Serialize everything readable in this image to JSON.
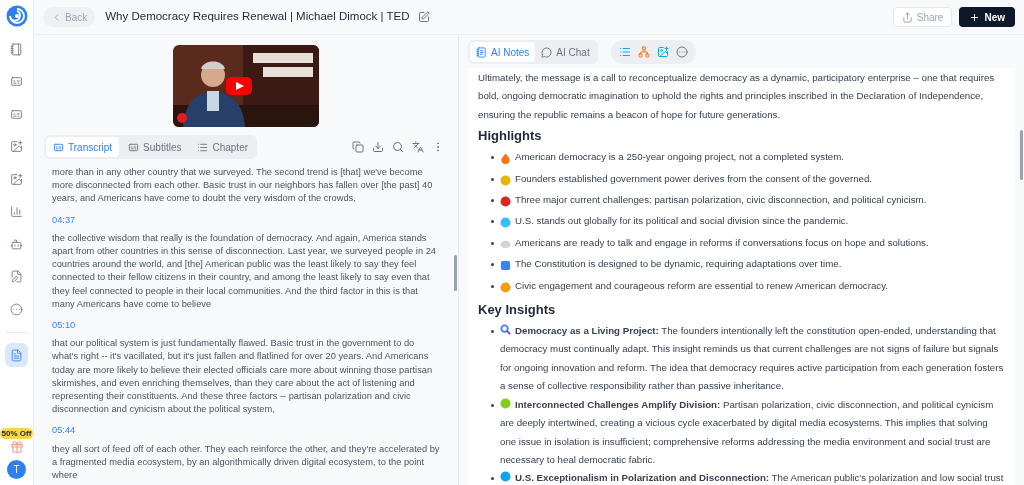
{
  "header": {
    "back": "Back",
    "title": "Why Democracy Requires Renewal | Michael Dimock | TED",
    "share": "Share",
    "new": "New"
  },
  "sidebar": {
    "items": [
      {
        "selected": false
      },
      {
        "selected": false
      },
      {
        "selected": false
      },
      {
        "selected": false
      },
      {
        "selected": false
      },
      {
        "selected": false
      },
      {
        "selected": false
      },
      {
        "selected": false
      },
      {
        "selected": false
      },
      {
        "selected": true
      }
    ],
    "promo": "50% Off",
    "avatar": "T"
  },
  "transcript_tabs": [
    {
      "label": "Transcript",
      "selected": true
    },
    {
      "label": "Subtitles",
      "selected": false
    },
    {
      "label": "Chapter",
      "selected": false
    }
  ],
  "transcript": [
    {
      "text": "more than in any other country that we surveyed. The second trend is [that] we've become more disconnected from each other. Basic trust in our neighbors has fallen over [the past] 40 years, and Americans have come to doubt the very wisdom of the crowds,"
    },
    {
      "time": "04:37",
      "text": "the collective wisdom that really is the foundation of democracy. And again, America stands apart from other countries in this sense of disconnection. Last year, we surveyed people in 24 countries around the world, and [the] American public was the least likely to say they feel connected to their fellow citizens in their country, and among the least likely to say even that they feel connected to people in their local communities. And the third factor in this is that many Americans have come to believe"
    },
    {
      "time": "05:10",
      "text": "that our political system is just fundamentally flawed. Basic trust in the government to do what's right -- it's vacillated, but it's just fallen and flatlined for over 20 years. And Americans today are more likely to believe their elected officials care more about winning those partisan skirmishes, and even enriching themselves, than they care about the act of listening and representing their constituents. And these three factors -- partisan polarization and civic disconnection and cynicism about the political system,"
    },
    {
      "time": "05:44",
      "text": "they all sort of feed off of each other. They each reinforce the other, and they're accelerated by a fragmented media ecosystem, by an algorithmically driven digital ecosystem, to the point where"
    }
  ],
  "notes_tabs": [
    {
      "label": "AI Notes",
      "selected": true
    },
    {
      "label": "AI Chat",
      "selected": false
    }
  ],
  "notes": {
    "intro": "Ultimately, the message is a call to reconceptualize democracy as a dynamic, participatory enterprise – one that requires bold, ongoing democratic imagination to uphold the rights and principles inscribed in the Declaration of Independence, ensuring the republic remains a beacon of hope for future generations.",
    "sections": [
      {
        "heading": "Highlights",
        "items": [
          "American democracy is a 250-year ongoing project, not a completed system.",
          "Founders established government power derives from the consent of the governed.",
          "Three major current challenges: partisan polarization, civic disconnection, and political cynicism.",
          "U.S. stands out globally for its political and social division since the pandemic.",
          "Americans are ready to talk and engage in reforms if conversations focus on hope and solutions.",
          "The Constitution is designed to be dynamic, requiring adaptations over time.",
          "Civic engagement and courageous reform are essential to renew American democracy."
        ]
      },
      {
        "heading": "Key Insights",
        "items": [
          "**Democracy as a Living Project:** The founders intentionally left the constitution open-ended, understanding that democracy must continually adapt. This insight reminds us that current challenges are not signs of failure but signals for ongoing innovation and reform. The idea that democracy requires active participation from each generation fosters a sense of collective responsibility rather than passive inheritance.",
          "**Interconnected Challenges Amplify Division:** Partisan polarization, civic disconnection, and political cynicism are deeply intertwined, creating a vicious cycle exacerbated by digital media ecosystems. This implies that solving one issue in isolation is insufficient; comprehensive reforms addressing the media environment and social trust are necessary to heal democratic fabric.",
          "**U.S. Exceptionalism in Polarization and Disconnection:** The American public's polarization and low social trust"
        ]
      }
    ]
  }
}
